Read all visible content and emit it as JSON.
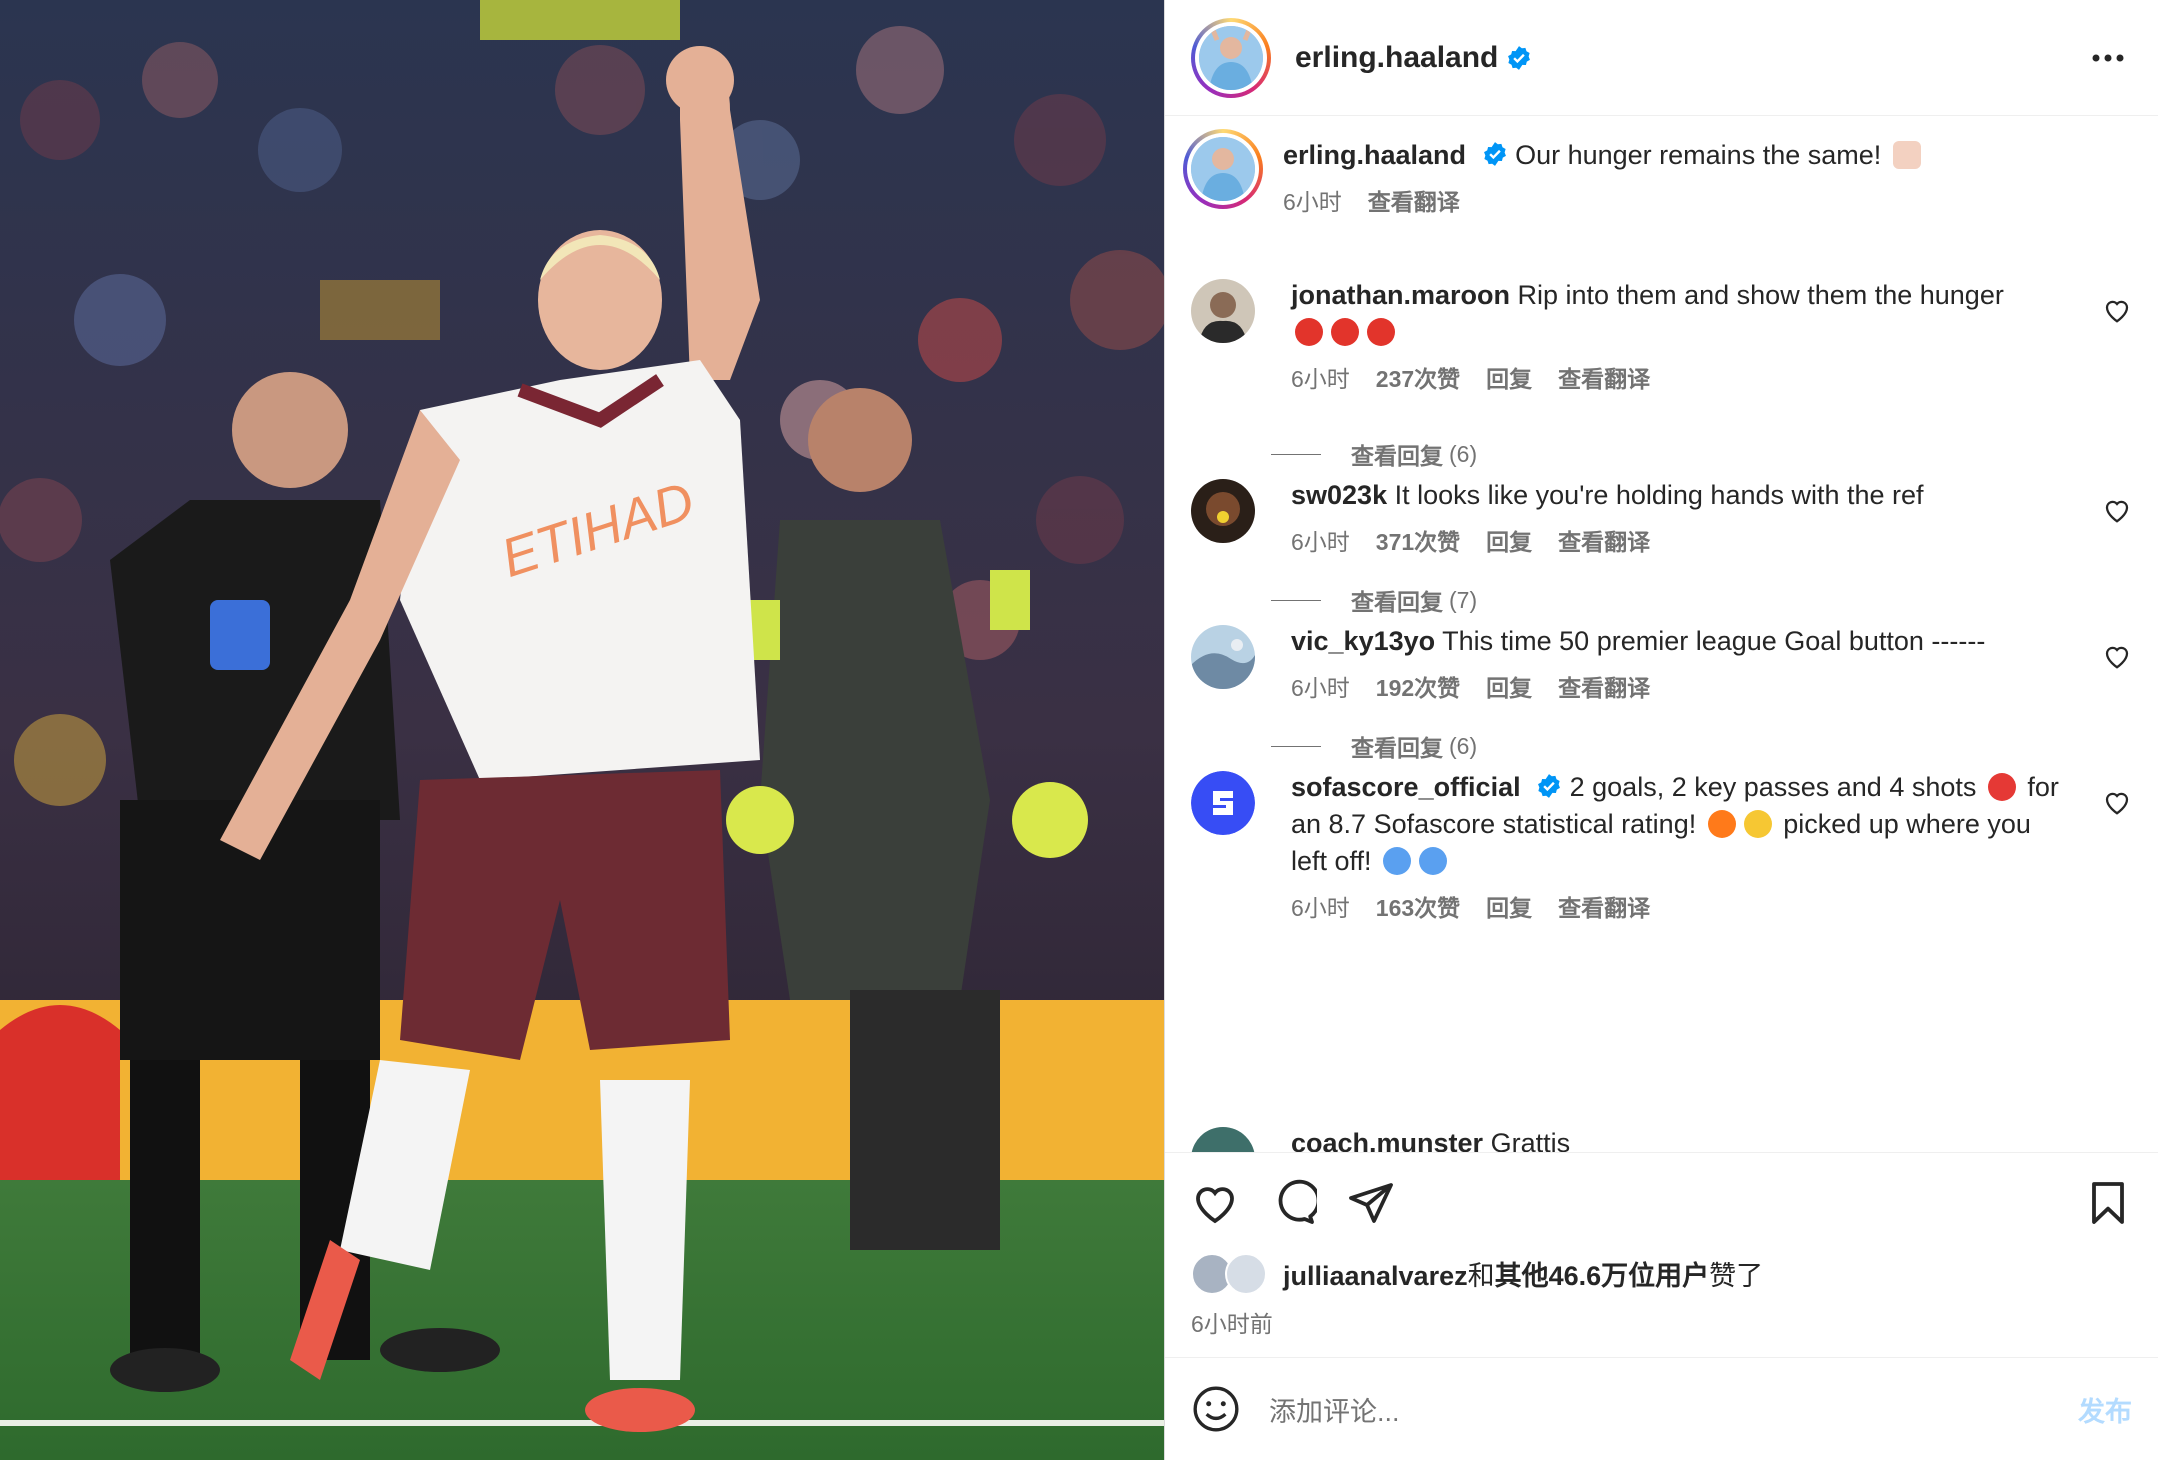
{
  "header": {
    "username": "erling.haaland"
  },
  "caption": {
    "username": "erling.haaland",
    "text": "Our hunger remains the same! ",
    "time": "6小时",
    "translate": "查看翻译"
  },
  "comments": [
    {
      "username": "jonathan.maroon",
      "text": "Rip into them and show them the hunger",
      "time": "6小时",
      "likes": "237次赞",
      "reply": "回复",
      "translate": "查看翻译",
      "view_replies": "查看回复",
      "reply_count": "(6)"
    },
    {
      "username": "sw023k",
      "text": "It looks like you're holding hands with the ref",
      "time": "6小时",
      "likes": "371次赞",
      "reply": "回复",
      "translate": "查看翻译",
      "view_replies": "查看回复",
      "reply_count": "(7)"
    },
    {
      "username": "vic_ky13yo",
      "text": "This time 50 premier league Goal button ------",
      "time": "6小时",
      "likes": "192次赞",
      "reply": "回复",
      "translate": "查看翻译",
      "view_replies": "查看回复",
      "reply_count": "(6)"
    },
    {
      "username": "sofascore_official",
      "text_a": "2 goals, 2 key passes and 4 shots ",
      "text_b": " for an 8.7 Sofascore statistical rating! ",
      "text_c": " picked up where you left off! ",
      "time": "6小时",
      "likes": "163次赞",
      "reply": "回复",
      "translate": "查看翻译"
    },
    {
      "username": "coach.munster",
      "text": "Grattis "
    }
  ],
  "likes_line": {
    "user": "julliaanalvarez",
    "mid": "和",
    "others": "其他46.6万位用户",
    "end": "赞了"
  },
  "post_time": "6小时前",
  "add_comment": {
    "placeholder": "添加评论...",
    "post": "发布"
  },
  "icons": [
    "heart-icon",
    "comment-icon",
    "share-icon",
    "bookmark-icon",
    "emoji-icon",
    "more-icon",
    "verified-icon"
  ]
}
